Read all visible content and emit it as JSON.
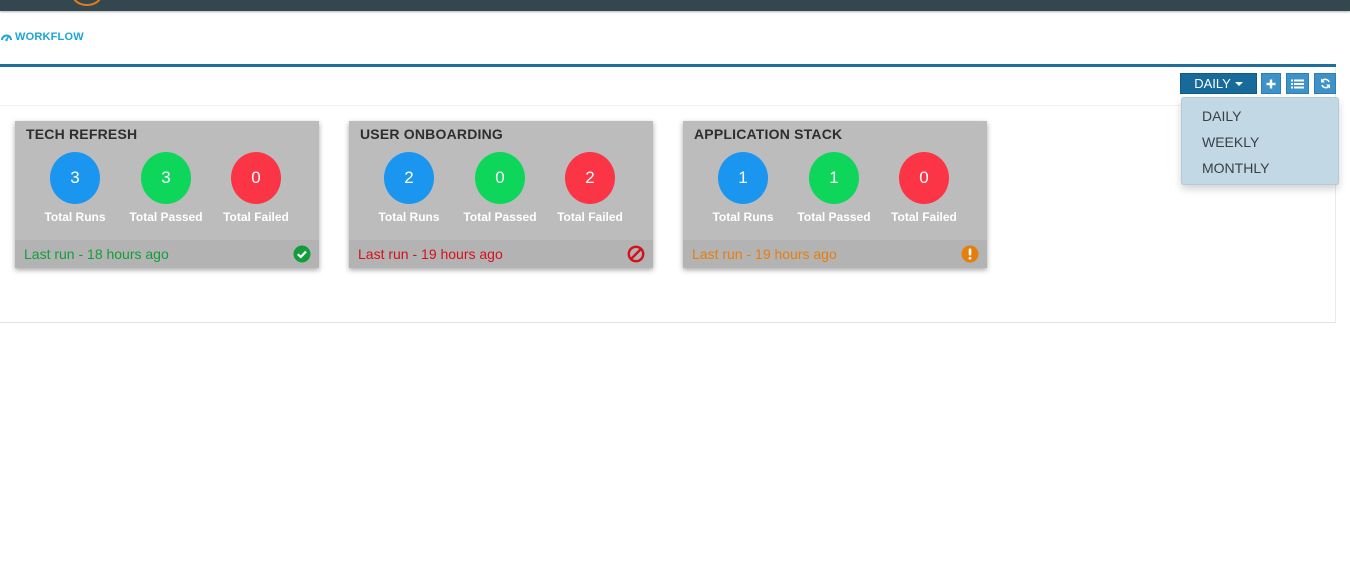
{
  "breadcrumb": {
    "label": "WORKFLOW",
    "icon": "dashboard-icon"
  },
  "toolbar": {
    "period_selected": "DAILY",
    "add_icon": "plus-icon",
    "list_icon": "list-icon",
    "refresh_icon": "refresh-icon"
  },
  "period_menu": {
    "options": [
      "DAILY",
      "WEEKLY",
      "MONTHLY"
    ]
  },
  "colors": {
    "runs": "#1a96f0",
    "passed": "#0ed65a",
    "failed": "#fb3545",
    "success_text": "#139d3a",
    "error_text": "#d5101c",
    "warning_text": "#e57e0d"
  },
  "cards": [
    {
      "title": "TECH REFRESH",
      "total_runs": "3",
      "total_passed": "3",
      "total_failed": "0",
      "labels": {
        "runs": "Total Runs",
        "passed": "Total Passed",
        "failed": "Total Failed"
      },
      "last_run": "Last run - 18 hours ago",
      "status": "success",
      "status_icon": "check-circle-icon"
    },
    {
      "title": "USER ONBOARDING",
      "total_runs": "2",
      "total_passed": "0",
      "total_failed": "2",
      "labels": {
        "runs": "Total Runs",
        "passed": "Total Passed",
        "failed": "Total Failed"
      },
      "last_run": "Last run - 19 hours ago",
      "status": "failed",
      "status_icon": "ban-icon"
    },
    {
      "title": "APPLICATION STACK",
      "total_runs": "1",
      "total_passed": "1",
      "total_failed": "0",
      "labels": {
        "runs": "Total Runs",
        "passed": "Total Passed",
        "failed": "Total Failed"
      },
      "last_run": "Last run - 19 hours ago",
      "status": "warning",
      "status_icon": "exclamation-circle-icon"
    }
  ]
}
